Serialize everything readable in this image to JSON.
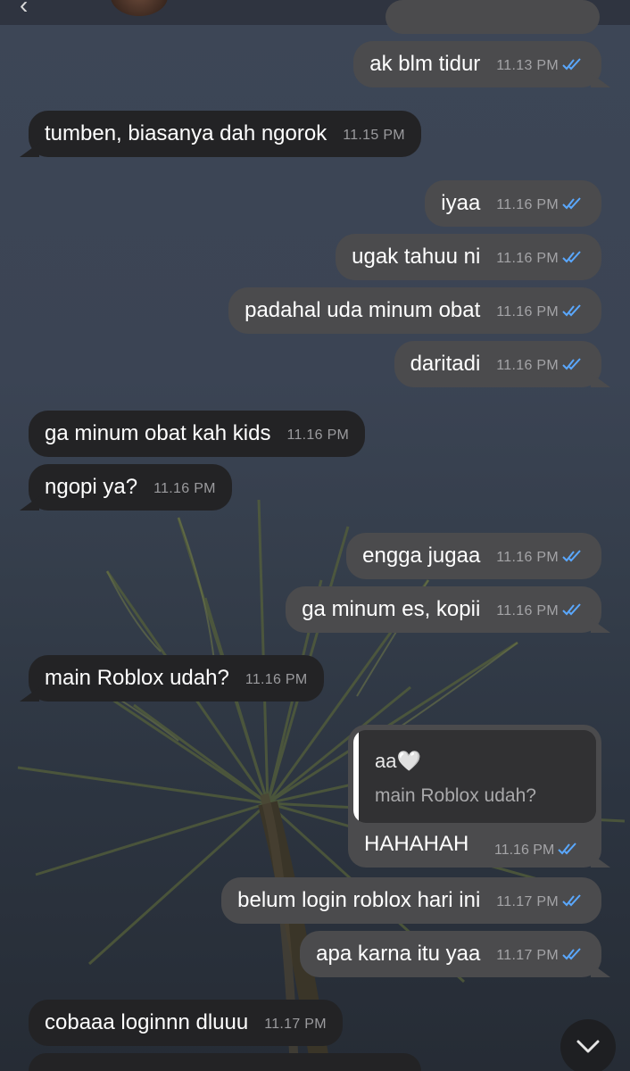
{
  "contact": {
    "name": "aa🤍"
  },
  "messages": [
    {
      "dir": "out",
      "text": "ak blm tidur",
      "time": "11.13 PM",
      "read": true
    },
    {
      "dir": "in",
      "text": "tumben, biasanya dah ngorok",
      "time": "11.15 PM"
    },
    {
      "dir": "out",
      "text": "iyaa",
      "time": "11.16 PM",
      "read": true
    },
    {
      "dir": "out",
      "text": "ugak tahuu ni",
      "time": "11.16 PM",
      "read": true
    },
    {
      "dir": "out",
      "text": "padahal uda minum obat",
      "time": "11.16 PM",
      "read": true
    },
    {
      "dir": "out",
      "text": "daritadi",
      "time": "11.16 PM",
      "read": true
    },
    {
      "dir": "in",
      "text": "ga minum obat kah kids",
      "time": "11.16 PM"
    },
    {
      "dir": "in",
      "text": "ngopi ya?",
      "time": "11.16 PM"
    },
    {
      "dir": "out",
      "text": "engga jugaa",
      "time": "11.16 PM",
      "read": true
    },
    {
      "dir": "out",
      "text": "ga minum es, kopii",
      "time": "11.16 PM",
      "read": true
    },
    {
      "dir": "in",
      "text": "main Roblox udah?",
      "time": "11.16 PM"
    },
    {
      "dir": "out",
      "text": "HAHAHAH",
      "time": "11.16 PM",
      "read": true,
      "reply_to": {
        "author": "aa🤍",
        "text": "main Roblox udah?"
      }
    },
    {
      "dir": "out",
      "text": "belum login roblox hari ini",
      "time": "11.17 PM",
      "read": true
    },
    {
      "dir": "out",
      "text": "apa karna itu yaa",
      "time": "11.17 PM",
      "read": true
    },
    {
      "dir": "in",
      "text": "cobaaa loginnn dluuu",
      "time": "11.17 PM"
    }
  ],
  "colors": {
    "outgoing_bubble": "#4b4b4d",
    "incoming_bubble": "#232325",
    "read_check": "#5aa8ff"
  },
  "icons": {
    "read_receipt": "double-check-icon",
    "scroll_down": "chevron-down-icon"
  }
}
